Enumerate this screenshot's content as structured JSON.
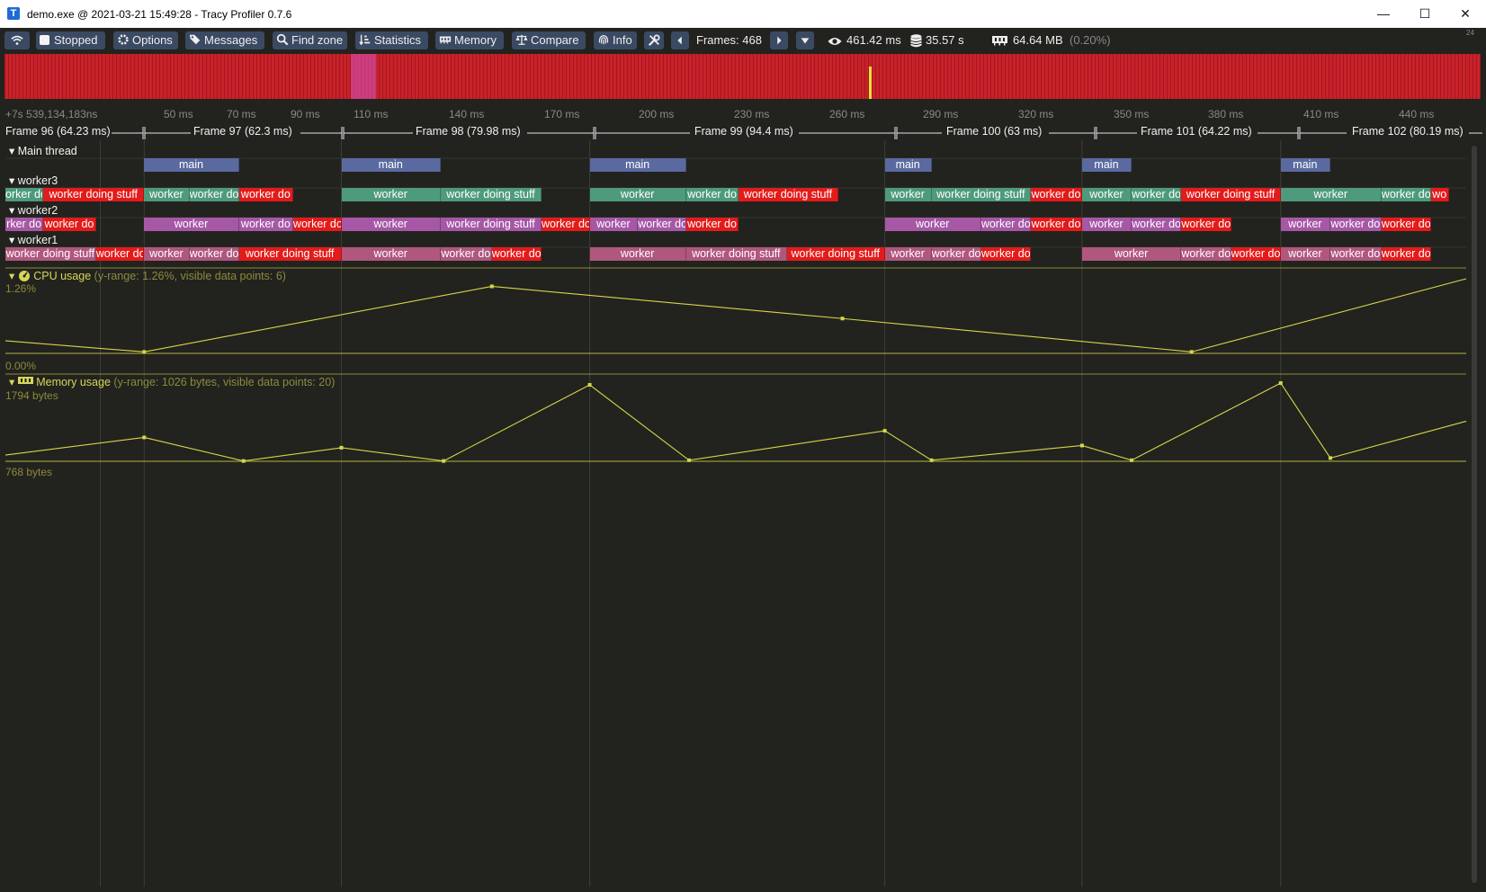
{
  "window": {
    "title": "demo.exe @ 2021-03-21 15:49:28 - Tracy Profiler 0.7.6",
    "app_icon_letter": "T",
    "min_glyph": "—",
    "max_glyph": "☐",
    "close_glyph": "✕"
  },
  "toolbar": {
    "stopped_label": "Stopped",
    "options_label": "Options",
    "messages_label": "Messages",
    "findzone_label": "Find zone",
    "statistics_label": "Statistics",
    "memory_label": "Memory",
    "compare_label": "Compare",
    "info_label": "Info",
    "frames_label": "Frames: 468",
    "view_time": "461.42 ms",
    "total_time": "35.57 s",
    "memory_used": "64.64 MB",
    "memory_pct": "(0.20%)",
    "corner_count": "24"
  },
  "timeline": {
    "origin": "+7s 539,134,183ns",
    "ticks": [
      "50 ms",
      "70 ms",
      "90 ms",
      "110 ms",
      "140 ms",
      "170 ms",
      "200 ms",
      "230 ms",
      "260 ms",
      "290 ms",
      "320 ms",
      "350 ms",
      "380 ms",
      "410 ms",
      "440 ms"
    ],
    "frames": [
      "Frame 96 (64.23 ms)",
      "Frame 97 (62.3 ms)",
      "Frame 98 (79.98 ms)",
      "Frame 99 (94.4 ms)",
      "Frame 100 (63 ms)",
      "Frame 101 (64.22 ms)",
      "Frame 102 (80.19 ms)"
    ]
  },
  "threads": {
    "main": {
      "label": "Main thread",
      "zones": [
        {
          "name": "main",
          "start": 0.095,
          "end": 0.16,
          "color": "#5a6aa0"
        },
        {
          "name": "main",
          "start": 0.23,
          "end": 0.298,
          "color": "#5a6aa0"
        },
        {
          "name": "main",
          "start": 0.4,
          "end": 0.466,
          "color": "#5a6aa0"
        },
        {
          "name": "main",
          "start": 0.602,
          "end": 0.634,
          "color": "#5a6aa0"
        },
        {
          "name": "main",
          "start": 0.737,
          "end": 0.771,
          "color": "#5a6aa0"
        },
        {
          "name": "main",
          "start": 0.873,
          "end": 0.907,
          "color": "#5a6aa0"
        }
      ]
    },
    "worker3": {
      "label": "worker3",
      "zones": [
        {
          "name": "orker do",
          "start": 0.0,
          "end": 0.026,
          "color": "#4e9a7c"
        },
        {
          "name": "worker doing stuff",
          "start": 0.026,
          "end": 0.095,
          "color": "#e31b1b"
        },
        {
          "name": "worker",
          "start": 0.095,
          "end": 0.126,
          "color": "#4e9a7c"
        },
        {
          "name": "worker do",
          "start": 0.126,
          "end": 0.16,
          "color": "#4e9a7c"
        },
        {
          "name": "worker do",
          "start": 0.16,
          "end": 0.197,
          "color": "#e31b1b"
        },
        {
          "name": "worker",
          "start": 0.23,
          "end": 0.298,
          "color": "#4e9a7c"
        },
        {
          "name": "worker doing stuff",
          "start": 0.298,
          "end": 0.367,
          "color": "#4e9a7c"
        },
        {
          "name": "worker",
          "start": 0.4,
          "end": 0.466,
          "color": "#4e9a7c"
        },
        {
          "name": "worker do",
          "start": 0.466,
          "end": 0.502,
          "color": "#4e9a7c"
        },
        {
          "name": "worker doing stuff",
          "start": 0.502,
          "end": 0.57,
          "color": "#e31b1b"
        },
        {
          "name": "worker",
          "start": 0.602,
          "end": 0.634,
          "color": "#4e9a7c"
        },
        {
          "name": "worker doing stuff",
          "start": 0.634,
          "end": 0.702,
          "color": "#4e9a7c"
        },
        {
          "name": "worker do",
          "start": 0.702,
          "end": 0.737,
          "color": "#e31b1b"
        },
        {
          "name": "worker",
          "start": 0.737,
          "end": 0.771,
          "color": "#4e9a7c"
        },
        {
          "name": "worker do",
          "start": 0.771,
          "end": 0.805,
          "color": "#4e9a7c"
        },
        {
          "name": "worker doing stuff",
          "start": 0.805,
          "end": 0.873,
          "color": "#e31b1b"
        },
        {
          "name": "worker",
          "start": 0.873,
          "end": 0.942,
          "color": "#4e9a7c"
        },
        {
          "name": "worker do",
          "start": 0.942,
          "end": 0.976,
          "color": "#4e9a7c"
        },
        {
          "name": "wo",
          "start": 0.976,
          "end": 0.988,
          "color": "#e31b1b"
        }
      ]
    },
    "worker2": {
      "label": "worker2",
      "zones": [
        {
          "name": "rker do",
          "start": 0.0,
          "end": 0.026,
          "color": "#a657a6"
        },
        {
          "name": "worker do",
          "start": 0.026,
          "end": 0.062,
          "color": "#e31b1b"
        },
        {
          "name": "worker",
          "start": 0.095,
          "end": 0.16,
          "color": "#a657a6"
        },
        {
          "name": "worker do",
          "start": 0.16,
          "end": 0.197,
          "color": "#a657a6"
        },
        {
          "name": "worker do",
          "start": 0.197,
          "end": 0.23,
          "color": "#e31b1b"
        },
        {
          "name": "worker",
          "start": 0.23,
          "end": 0.298,
          "color": "#a657a6"
        },
        {
          "name": "worker doing stuff",
          "start": 0.298,
          "end": 0.367,
          "color": "#a657a6"
        },
        {
          "name": "worker do",
          "start": 0.367,
          "end": 0.4,
          "color": "#e31b1b"
        },
        {
          "name": "worker",
          "start": 0.4,
          "end": 0.433,
          "color": "#a657a6"
        },
        {
          "name": "worker do",
          "start": 0.433,
          "end": 0.466,
          "color": "#a657a6"
        },
        {
          "name": "worker do",
          "start": 0.466,
          "end": 0.502,
          "color": "#e31b1b"
        },
        {
          "name": "worker",
          "start": 0.602,
          "end": 0.668,
          "color": "#a657a6"
        },
        {
          "name": "worker do",
          "start": 0.668,
          "end": 0.702,
          "color": "#a657a6"
        },
        {
          "name": "worker do",
          "start": 0.702,
          "end": 0.737,
          "color": "#e31b1b"
        },
        {
          "name": "worker",
          "start": 0.737,
          "end": 0.771,
          "color": "#a657a6"
        },
        {
          "name": "worker do",
          "start": 0.771,
          "end": 0.805,
          "color": "#a657a6"
        },
        {
          "name": "worker do",
          "start": 0.805,
          "end": 0.839,
          "color": "#e31b1b"
        },
        {
          "name": "worker",
          "start": 0.873,
          "end": 0.907,
          "color": "#a657a6"
        },
        {
          "name": "worker do",
          "start": 0.907,
          "end": 0.942,
          "color": "#a657a6"
        },
        {
          "name": "worker do",
          "start": 0.942,
          "end": 0.976,
          "color": "#e31b1b"
        }
      ]
    },
    "worker1": {
      "label": "worker1",
      "zones": [
        {
          "name": "worker doing stuff",
          "start": 0.0,
          "end": 0.062,
          "color": "#b0577e"
        },
        {
          "name": "worker do",
          "start": 0.062,
          "end": 0.095,
          "color": "#e31b1b"
        },
        {
          "name": "worker",
          "start": 0.095,
          "end": 0.126,
          "color": "#b0577e"
        },
        {
          "name": "worker do",
          "start": 0.126,
          "end": 0.16,
          "color": "#b0577e"
        },
        {
          "name": "worker doing stuff",
          "start": 0.16,
          "end": 0.23,
          "color": "#e31b1b"
        },
        {
          "name": "worker",
          "start": 0.23,
          "end": 0.298,
          "color": "#b0577e"
        },
        {
          "name": "worker do",
          "start": 0.298,
          "end": 0.333,
          "color": "#b0577e"
        },
        {
          "name": "worker do",
          "start": 0.333,
          "end": 0.367,
          "color": "#e31b1b"
        },
        {
          "name": "worker",
          "start": 0.4,
          "end": 0.466,
          "color": "#b0577e"
        },
        {
          "name": "worker doing stuff",
          "start": 0.466,
          "end": 0.535,
          "color": "#b0577e"
        },
        {
          "name": "worker doing stuff",
          "start": 0.535,
          "end": 0.602,
          "color": "#e31b1b"
        },
        {
          "name": "worker",
          "start": 0.602,
          "end": 0.634,
          "color": "#b0577e"
        },
        {
          "name": "worker do",
          "start": 0.634,
          "end": 0.668,
          "color": "#b0577e"
        },
        {
          "name": "worker do",
          "start": 0.668,
          "end": 0.702,
          "color": "#e31b1b"
        },
        {
          "name": "worker",
          "start": 0.737,
          "end": 0.805,
          "color": "#b0577e"
        },
        {
          "name": "worker do",
          "start": 0.805,
          "end": 0.839,
          "color": "#b0577e"
        },
        {
          "name": "worker do",
          "start": 0.839,
          "end": 0.873,
          "color": "#e31b1b"
        },
        {
          "name": "worker",
          "start": 0.873,
          "end": 0.907,
          "color": "#b0577e"
        },
        {
          "name": "worker do",
          "start": 0.907,
          "end": 0.942,
          "color": "#b0577e"
        },
        {
          "name": "worker do",
          "start": 0.942,
          "end": 0.976,
          "color": "#e31b1b"
        }
      ]
    }
  },
  "chart_data": [
    {
      "type": "line",
      "title": "CPU usage",
      "subtitle": "(y-range: 1.26%, visible data points: 6)",
      "y_max_label": "1.26%",
      "y_min_label": "0.00%",
      "ylim": [
        0,
        1.26
      ],
      "x": [
        0.0,
        0.095,
        0.333,
        0.573,
        0.812,
        1.0
      ],
      "values": [
        0.2,
        0.01,
        1.13,
        0.58,
        0.01,
        1.26
      ],
      "marker_count": 4,
      "color": "#d6d64a"
    },
    {
      "type": "line",
      "title": "Memory usage",
      "subtitle": "(y-range: 1026 bytes, visible data points: 20)",
      "y_max_label": "1794 bytes",
      "y_min_label": "768 bytes",
      "ylim": [
        768,
        1794
      ],
      "x": [
        0.0,
        0.095,
        0.163,
        0.23,
        0.3,
        0.4,
        0.468,
        0.602,
        0.634,
        0.737,
        0.771,
        0.873,
        0.907,
        1.0
      ],
      "values": [
        840,
        1080,
        760,
        940,
        760,
        1794,
        770,
        1170,
        770,
        970,
        770,
        1840,
        800,
        1300
      ],
      "color": "#d6d64a"
    }
  ],
  "colors": {
    "background": "#22231e",
    "button": "#3b4a63",
    "frame_overview": "#c8222a",
    "plot_line": "#d6d64a",
    "plot_label": "#d8d55a"
  }
}
